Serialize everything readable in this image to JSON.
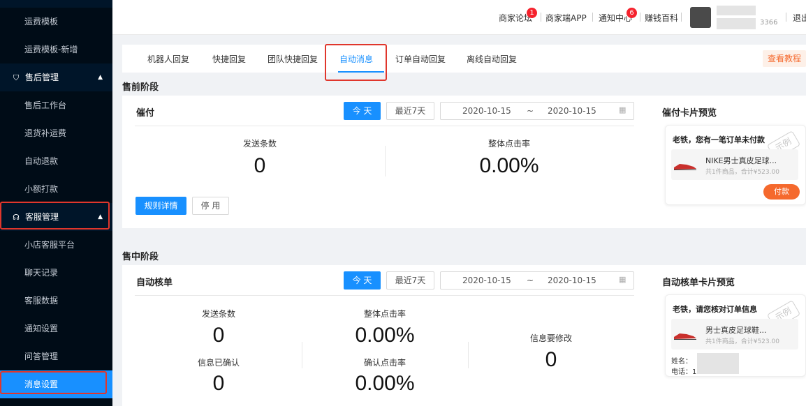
{
  "sidebar": {
    "items": [
      {
        "label": "运费模板"
      },
      {
        "label": "运费模板-新增"
      },
      {
        "label": "售后管理",
        "icon": "shield-icon"
      },
      {
        "label": "售后工作台"
      },
      {
        "label": "退货补运费"
      },
      {
        "label": "自动退款"
      },
      {
        "label": "小额打款"
      },
      {
        "label": "客服管理",
        "icon": "headset-icon"
      },
      {
        "label": "小店客服平台"
      },
      {
        "label": "聊天记录"
      },
      {
        "label": "客服数据"
      },
      {
        "label": "通知设置"
      },
      {
        "label": "问答管理"
      },
      {
        "label": "消息设置"
      }
    ]
  },
  "header": {
    "forum": "商家论坛",
    "forum_badge": "1",
    "app": "商家端APP",
    "notify": "通知中心",
    "notify_badge": "6",
    "wiki": "赚钱百科",
    "user_suffix": "3366",
    "logout": "退出"
  },
  "tabs": {
    "items": [
      "机器人回复",
      "快捷回复",
      "团队快捷回复",
      "自动消息",
      "订单自动回复",
      "离线自动回复"
    ],
    "active": "自动消息",
    "tutorial": "查看教程"
  },
  "presale": {
    "stage_title": "售前阶段",
    "card_title": "催付",
    "today": "今 天",
    "last7": "最近7天",
    "start_date": "2020-10-15",
    "range_sep": "~",
    "end_date": "2020-10-15",
    "sent_label": "发送条数",
    "sent_value": "0",
    "click_label": "整体点击率",
    "click_value": "0.00%",
    "rule_btn": "规则详情",
    "disable_btn": "停 用",
    "preview_title": "催付卡片预览",
    "preview": {
      "headline": "老铁，您有一笔订单未付款",
      "product": "NIKE男士真皮足球...",
      "summary": "共1件商品，合计¥523.00",
      "pay": "付款",
      "stamp": "示例"
    }
  },
  "midsale": {
    "stage_title": "售中阶段",
    "card_title": "自动核单",
    "today": "今 天",
    "last7": "最近7天",
    "start_date": "2020-10-15",
    "range_sep": "~",
    "end_date": "2020-10-15",
    "sent_label": "发送条数",
    "sent_value": "0",
    "click_label": "整体点击率",
    "click_value": "0.00%",
    "modify_label": "信息要修改",
    "modify_value": "0",
    "confirmed_label": "信息已确认",
    "confirmed_value": "0",
    "confirm_rate_label": "确认点击率",
    "confirm_rate_value": "0.00%",
    "preview_title": "自动核单卡片预览",
    "preview": {
      "headline": "老铁，请您核对订单信息",
      "product": "男士真皮足球鞋...",
      "summary": "共1件商品，合计¥523.00",
      "name_label": "姓名：",
      "phone_label": "电话：1",
      "stamp": "示例"
    }
  },
  "colors": {
    "sidebar_bg": "#001529",
    "primary": "#1890ff",
    "highlight_box": "#e0362c",
    "tutorial": "#f5692d"
  }
}
